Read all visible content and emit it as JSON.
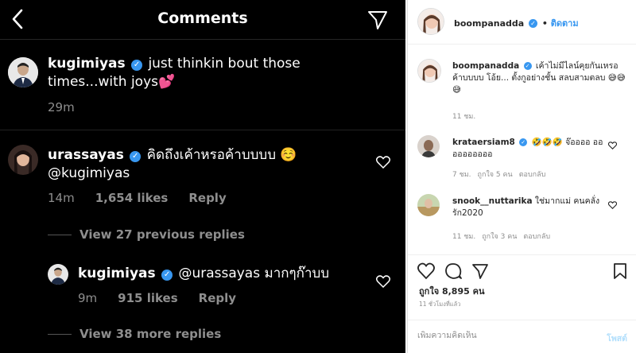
{
  "left": {
    "title": "Comments",
    "comments": [
      {
        "username": "kugimiyas",
        "text": "just thinkin bout those times...with joys💕",
        "time": "29m"
      },
      {
        "username": "urassayas",
        "text": "คิดถึงเค้าหรอค้าบบบบ ☺️",
        "mention": "@kugimiyas",
        "time": "14m",
        "likes": "1,654 likes",
        "reply": "Reply",
        "view_replies": "View 27 previous replies"
      },
      {
        "username": "kugimiyas",
        "text": "@urassayas มากๆก๊าบบ",
        "time": "9m",
        "likes": "915 likes",
        "reply": "Reply",
        "view_replies": "View 38 more replies"
      }
    ]
  },
  "right": {
    "header": {
      "username": "boompanadda",
      "follow_label": "ติดตาม",
      "separator": "•"
    },
    "caption": {
      "username": "boompanadda",
      "text": "เค้าไม่มีไลน์คุยกันเหรอค้าบบบบ โอ้ย... ตั้งกูอย่างชั้น สลบสามตลบ 😅😅😅",
      "time": "11 ชม."
    },
    "comments": [
      {
        "username": "krataersiam8",
        "text": "🤣🤣🤣 จ๊ออออ ออออออออออ",
        "time": "7 ชม.",
        "likes": "ถูกใจ 5 คน",
        "reply": "ตอบกลับ"
      },
      {
        "username": "snook__nuttarika",
        "text": "ใช่มากแม่ คนคลั่งรัก2020",
        "time": "11 ชม.",
        "likes": "ถูกใจ 3 คน",
        "reply": "ตอบกลับ"
      }
    ],
    "likes": "ถูกใจ 8,895 คน",
    "posted_ago": "11 ชั่วโมงที่แล้ว",
    "add_comment_placeholder": "เพิ่มความคิดเห็น",
    "post_label": "โพสต์",
    "colors": {
      "verified": "#3897f0",
      "link": "#3897f0"
    }
  }
}
